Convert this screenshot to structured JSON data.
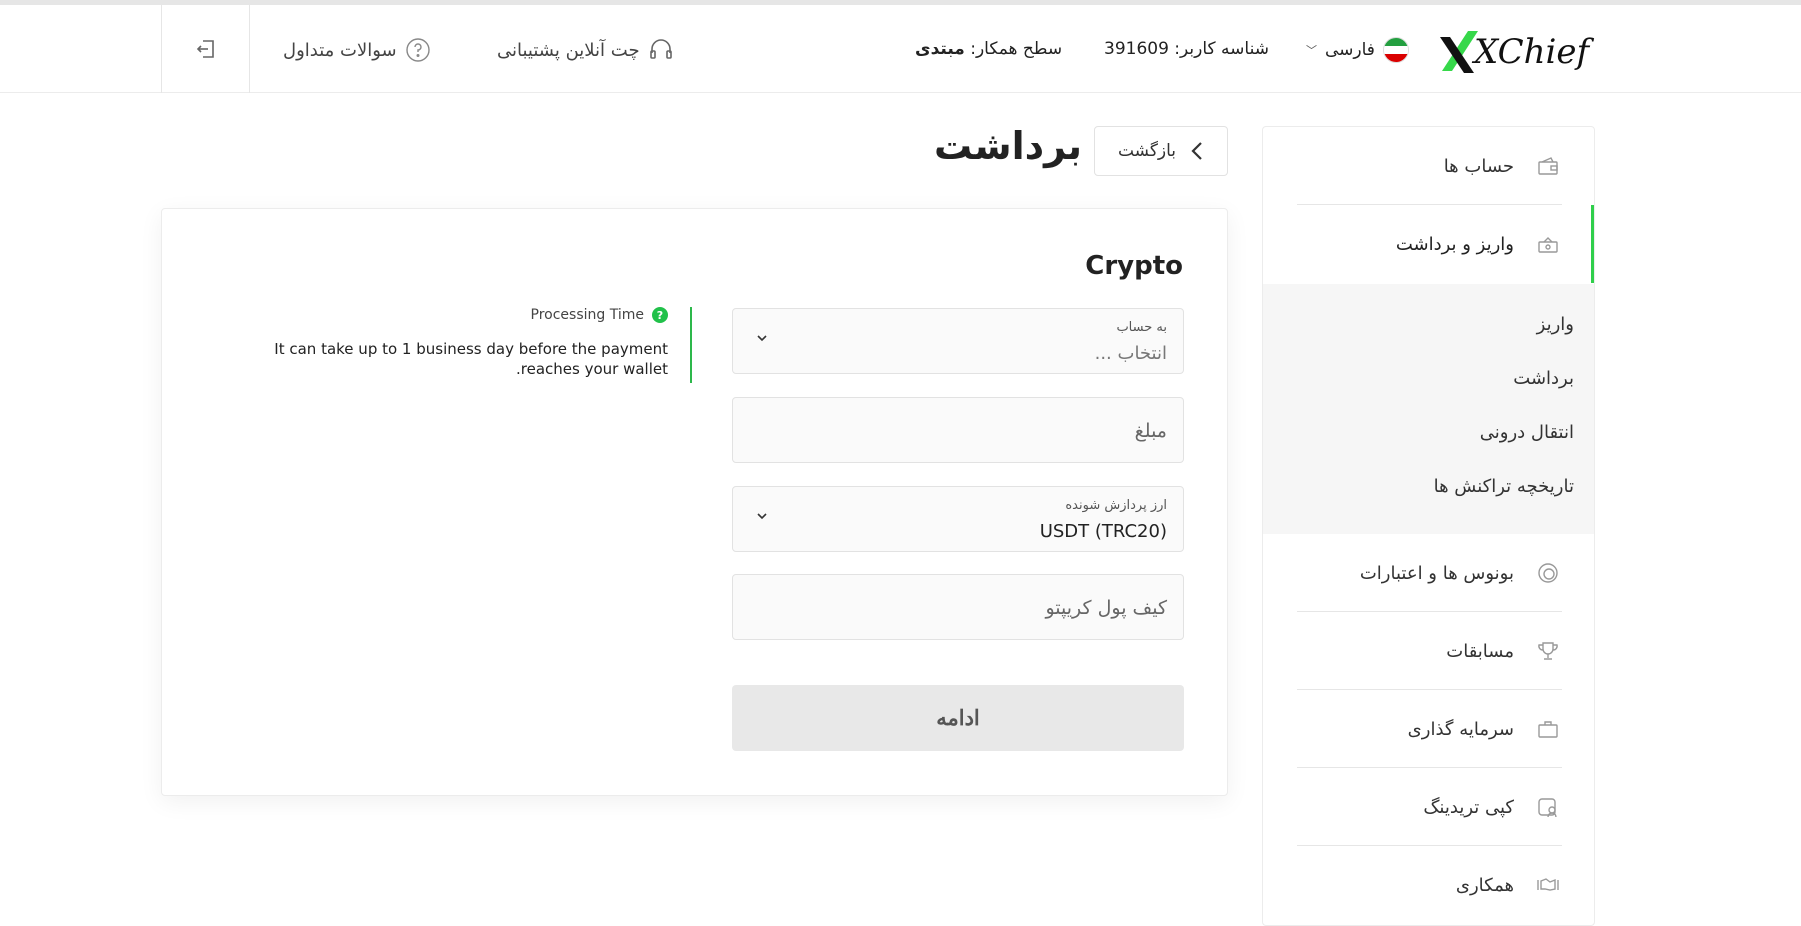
{
  "header": {
    "logo_text": "XChief",
    "language": "فارسی",
    "user_id": "شناسه کاربر: 391609",
    "partner_level_label": "سطح همکار:",
    "partner_level_value": "مبتدی",
    "chat": "چت آنلاین پشتیبانی",
    "faq": "سوالات متداول"
  },
  "page": {
    "back": "بازگشت",
    "title": "برداشت"
  },
  "form": {
    "title": "Crypto",
    "account_label": "به حساب",
    "account_placeholder": "انتخاب ...",
    "amount_placeholder": "مبلغ",
    "currency_label": "ارز پردازش شونده",
    "currency_value": "USDT (TRC20)",
    "wallet_placeholder": "کیف پول کریپتو",
    "submit": "ادامه"
  },
  "info": {
    "title": "Processing Time",
    "help_icon": "?",
    "text": "It can take up to 1 business day before the payment reaches your wallet."
  },
  "sidebar": {
    "accounts": "حساب ها",
    "deposit_withdraw": "واریز و برداشت",
    "sub": {
      "deposit": "واریز",
      "withdraw": "برداشت",
      "transfer": "انتقال درونی",
      "history": "تاریخچه تراکنش ها"
    },
    "bonuses": "بونوس ها و اعتبارات",
    "contests": "مسابقات",
    "invest": "سرمایه گذاری",
    "copy_trading": "کپی تریدینگ",
    "partnership": "همکاری"
  },
  "colors": {
    "accent": "#2fcf4b",
    "flag_green": "#239f40",
    "flag_red": "#da0000"
  },
  "icons": [
    "logout-icon",
    "question-circle-icon",
    "headset-icon",
    "chevron-down-icon",
    "chevron-left-icon",
    "wallet-icon",
    "cash-icon",
    "coins-icon",
    "trophy-icon",
    "briefcase-icon",
    "copy-user-icon",
    "handshake-icon"
  ]
}
